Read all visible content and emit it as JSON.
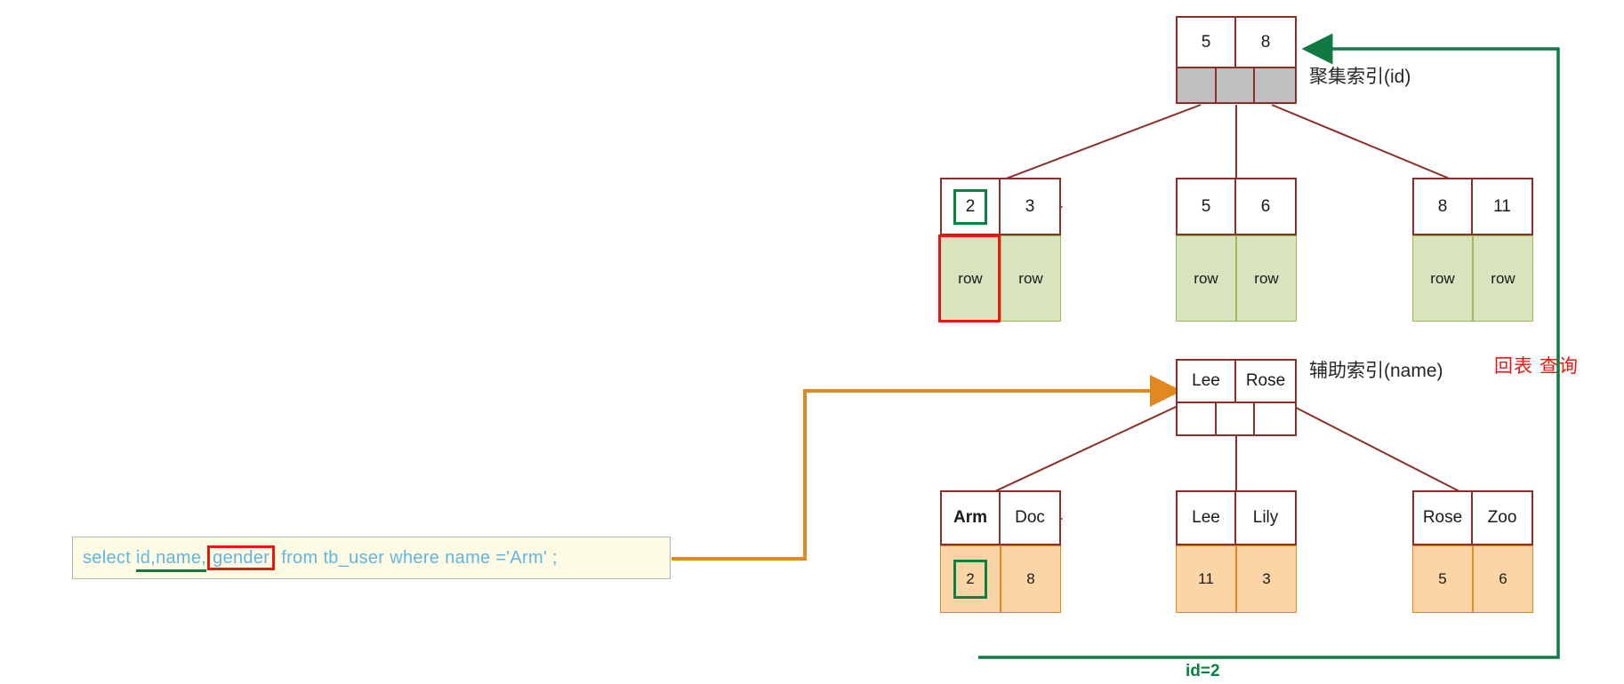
{
  "diagram": {
    "title_clustered": "聚集索引(id)",
    "title_secondary": "辅助索引(name)",
    "label_back_to_table": "回表 查询",
    "label_id_equals": "id=2"
  },
  "sql": {
    "kw_select": "select",
    "cols_underlined": "id,name,",
    "col_boxed": "gender",
    "kw_from": "from",
    "table": "tb_user",
    "kw_where": "where",
    "predicate": "name ='Arm' ;",
    "full": "select id,name,gender from tb_user where name ='Arm' ;"
  },
  "clustered_index": {
    "root": {
      "keys": [
        "5",
        "8"
      ],
      "pointers": [
        "",
        "",
        ""
      ]
    },
    "leaves": [
      {
        "keys": [
          "2",
          "3"
        ],
        "highlight_key": "2",
        "data": [
          "row",
          "row"
        ],
        "highlight_data_index": 0
      },
      {
        "keys": [
          "5",
          "6"
        ],
        "highlight_key": null,
        "data": [
          "row",
          "row"
        ],
        "highlight_data_index": null
      },
      {
        "keys": [
          "8",
          "11"
        ],
        "highlight_key": null,
        "data": [
          "row",
          "row"
        ],
        "highlight_data_index": null
      }
    ]
  },
  "secondary_index": {
    "root": {
      "keys": [
        "Lee",
        "Rose"
      ],
      "pointers": [
        "",
        "",
        ""
      ]
    },
    "leaves": [
      {
        "keys": [
          "Arm",
          "Doc"
        ],
        "bold_key_index": 0,
        "data": [
          "2",
          "8"
        ],
        "highlight_data_index": 0
      },
      {
        "keys": [
          "Lee",
          "Lily"
        ],
        "bold_key_index": null,
        "data": [
          "11",
          "3"
        ],
        "highlight_data_index": null
      },
      {
        "keys": [
          "Rose",
          "Zoo"
        ],
        "bold_key_index": null,
        "data": [
          "5",
          "6"
        ],
        "highlight_data_index": null
      }
    ]
  },
  "colors": {
    "node_border": "#8c2f2a",
    "green_highlight": "#0b8043",
    "red_highlight": "#e8170f",
    "orange_arrow": "#e0891e",
    "green_arrow": "#117a43",
    "leaf_green_fill": "#d7e4bd",
    "leaf_orange_fill": "#fbd5a5",
    "pointer_gray": "#bfbfbf",
    "sql_text": "#64b5dd",
    "sql_bg": "#fdfbe4"
  }
}
